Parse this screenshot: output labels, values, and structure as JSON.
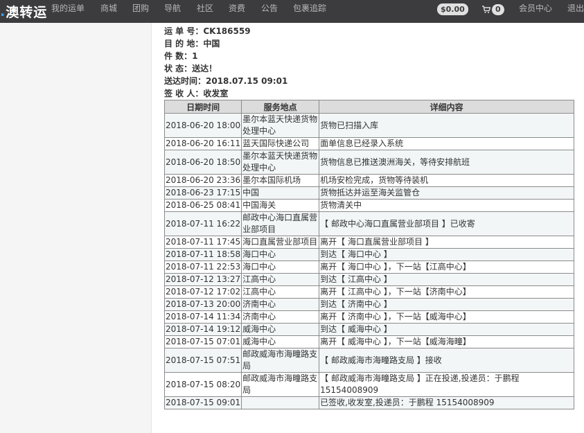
{
  "header": {
    "logo": "澳转运",
    "nav": [
      "我的运单",
      "商城",
      "团购",
      "导航",
      "社区",
      "资费",
      "公告",
      "包裹追踪"
    ],
    "balance": "$0.00",
    "cart_count": "0",
    "member_center": "会员中心",
    "logout": "退出"
  },
  "shipment": {
    "lines": [
      "运 单 号：CK186559",
      "目 的 地：中国",
      "件    数：1",
      "状    态：送达！",
      "送达时间：2018.07.15 09:01",
      "签 收 人：收发室"
    ]
  },
  "table": {
    "headers": [
      "日期时间",
      "服务地点",
      "详细内容"
    ],
    "rows": [
      {
        "date": "2018-06-20 18:00",
        "location": "墨尔本蓝天快递货物处理中心",
        "detail": "货物已扫描入库"
      },
      {
        "date": "2018-06-20 16:11",
        "location": "蓝天国际快递公司",
        "detail": "面单信息已经录入系统"
      },
      {
        "date": "2018-06-20 18:50",
        "location": "墨尔本蓝天快递货物处理中心",
        "detail": "货物信息已推送澳洲海关，等待安排航班"
      },
      {
        "date": "2018-06-20 23:36",
        "location": "墨尔本国际机场",
        "detail": "机场安检完成，货物等待装机"
      },
      {
        "date": "2018-06-23 17:15",
        "location": "中国",
        "detail": "货物抵达并运至海关监管仓"
      },
      {
        "date": "2018-06-25 08:41",
        "location": "中国海关",
        "detail": "货物清关中"
      },
      {
        "date": "2018-07-11 16:22",
        "location": "邮政中心海口直属营业部项目",
        "detail": "【 邮政中心海口直属营业部项目 】已收寄"
      },
      {
        "date": "2018-07-11 17:45",
        "location": "海口直属营业部项目",
        "detail": "离开【 海口直属营业部项目 】"
      },
      {
        "date": "2018-07-11 18:58",
        "location": "海口中心",
        "detail": "到达【 海口中心 】"
      },
      {
        "date": "2018-07-11 22:53",
        "location": "海口中心",
        "detail": "离开【 海口中心 】，下一站【江高中心】"
      },
      {
        "date": "2018-07-12 13:27",
        "location": "江高中心",
        "detail": "到达【 江高中心 】"
      },
      {
        "date": "2018-07-12 17:02",
        "location": "江高中心",
        "detail": "离开【 江高中心 】，下一站【济南中心】"
      },
      {
        "date": "2018-07-13 20:00",
        "location": "济南中心",
        "detail": "到达【 济南中心 】"
      },
      {
        "date": "2018-07-14 11:34",
        "location": "济南中心",
        "detail": "离开【 济南中心 】，下一站【威海中心】"
      },
      {
        "date": "2018-07-14 19:12",
        "location": "威海中心",
        "detail": "到达【 威海中心 】"
      },
      {
        "date": "2018-07-15 07:01",
        "location": "威海中心",
        "detail": "离开【 威海中心 】，下一站【威海海疃】"
      },
      {
        "date": "2018-07-15 07:51",
        "location": "邮政威海市海疃路支局",
        "detail": "【 邮政威海市海疃路支局 】接收"
      },
      {
        "date": "2018-07-15 08:20",
        "location": "邮政威海市海疃路支局",
        "detail": "【 邮政威海市海疃路支局 】正在投递,投递员：于鹏程 15154008909"
      },
      {
        "date": "2018-07-15 09:01",
        "location": "",
        "detail": "已签收,收发室,投递员：于鹏程 15154008909"
      }
    ]
  }
}
